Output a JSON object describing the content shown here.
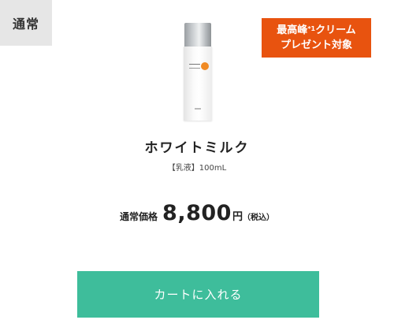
{
  "tag": {
    "label": "通常"
  },
  "promo": {
    "line1_prefix": "最高峰",
    "line1_sup": "*1",
    "line1_suffix": "クリーム",
    "line2": "プレゼント対象",
    "color": "#e8530f"
  },
  "product": {
    "image_icon": "milk-bottle",
    "name": "ホワイトミルク",
    "type": "【乳液】100mL"
  },
  "price": {
    "label": "通常価格",
    "value": "8,800",
    "unit": "円",
    "tax": "（税込）"
  },
  "cart": {
    "button_label": "カートに入れる",
    "color": "#3ebd9b"
  }
}
